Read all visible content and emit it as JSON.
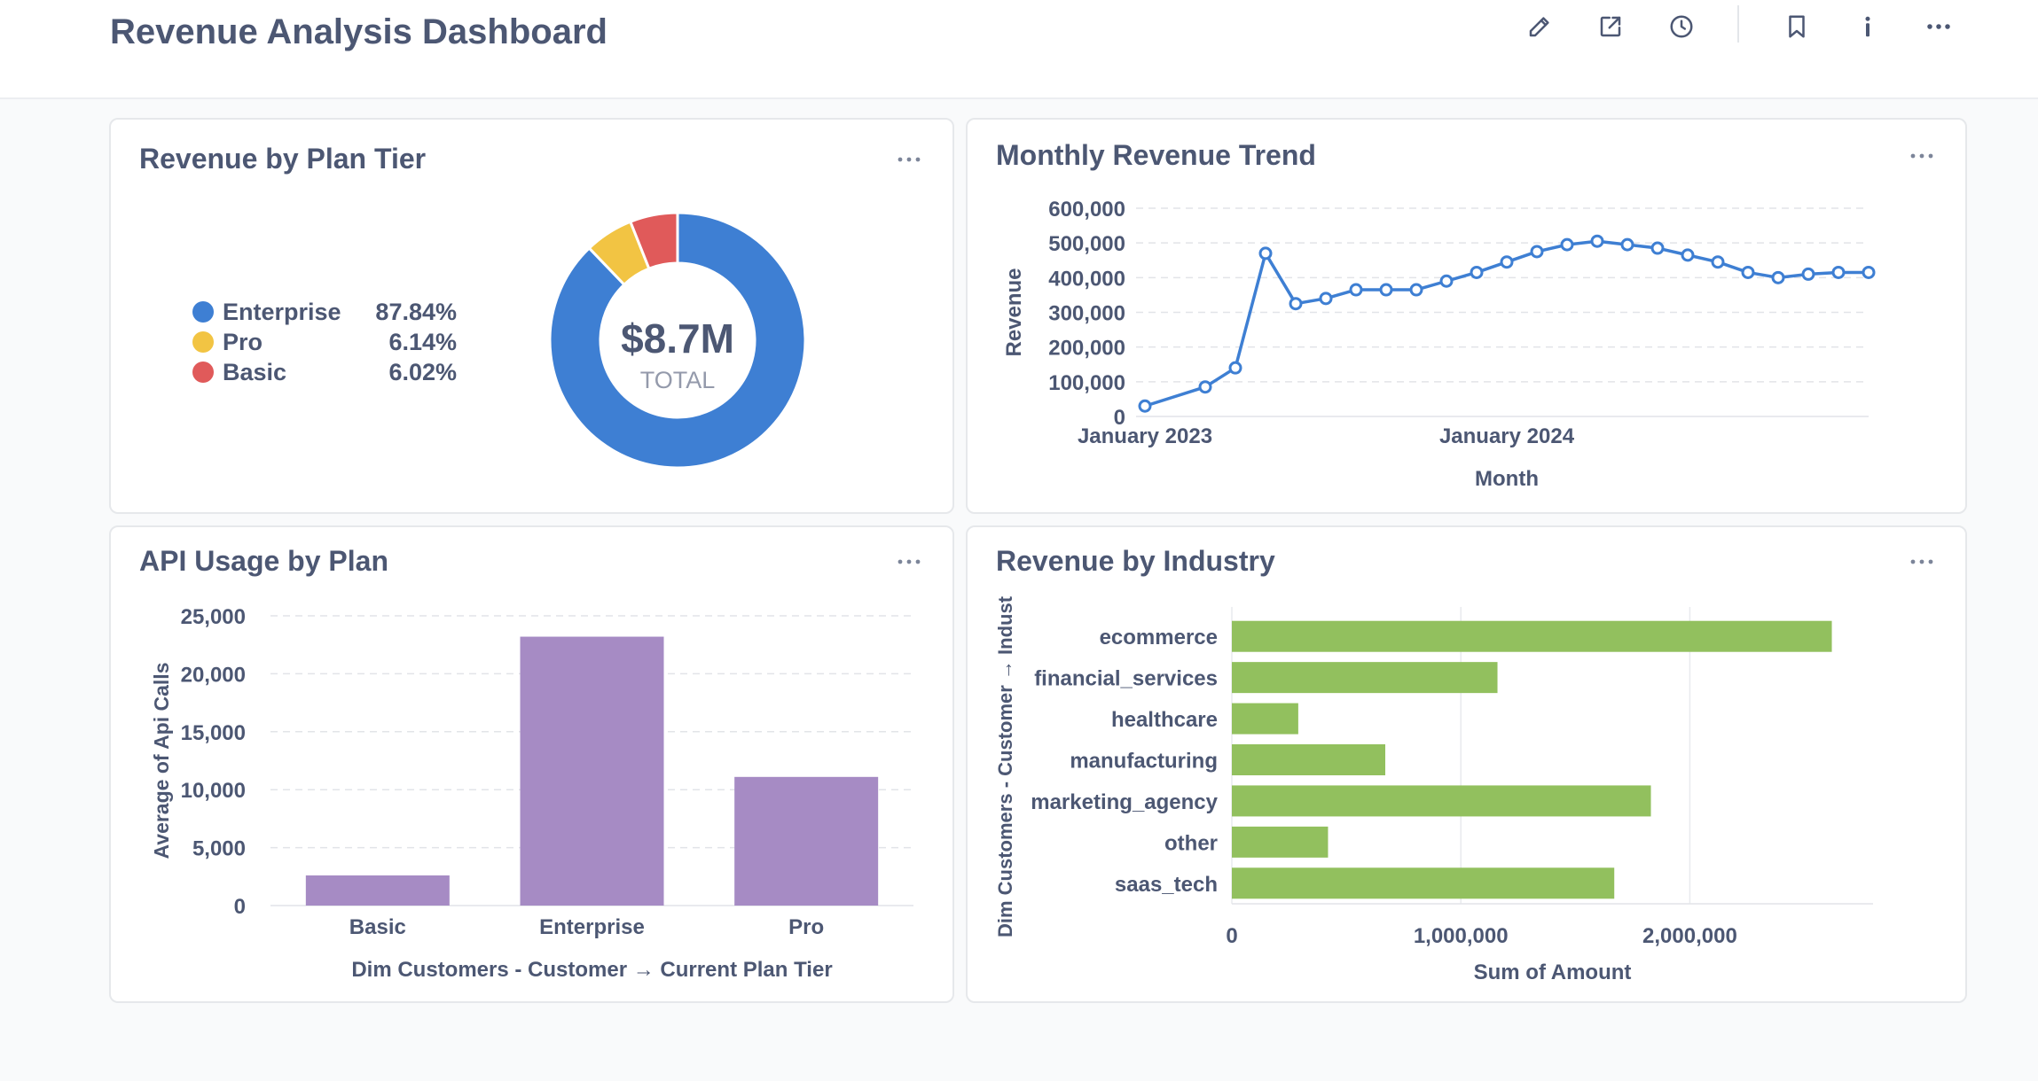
{
  "header": {
    "title": "Revenue Analysis Dashboard",
    "icons": [
      "pencil-icon",
      "share-icon",
      "history-icon",
      "bookmark-icon",
      "info-icon",
      "more-icon"
    ]
  },
  "colors": {
    "accent": "#509ee3",
    "enterprise": "#3e7fd3",
    "pro": "#f2c443",
    "basic": "#e05a5a",
    "line": "#3e7fd3",
    "api_bar": "#a68bc4",
    "industry_bar": "#92c05e"
  },
  "cards": {
    "plan_tier": {
      "title": "Revenue by Plan Tier",
      "center_value": "$8.7M",
      "center_label": "TOTAL"
    },
    "monthly_trend": {
      "title": "Monthly Revenue Trend"
    },
    "api_usage": {
      "title": "API Usage by Plan"
    },
    "industry": {
      "title": "Revenue by Industry"
    }
  },
  "chart_data": [
    {
      "type": "pie",
      "title": "Revenue by Plan Tier",
      "donut": true,
      "legend_position": "left",
      "slices": [
        {
          "label": "Enterprise",
          "percent": 87.84,
          "percent_label": "87.84%",
          "color": "#3e7fd3"
        },
        {
          "label": "Pro",
          "percent": 6.14,
          "percent_label": "6.14%",
          "color": "#f2c443"
        },
        {
          "label": "Basic",
          "percent": 6.02,
          "percent_label": "6.02%",
          "color": "#e05a5a"
        }
      ]
    },
    {
      "type": "line",
      "title": "Monthly Revenue Trend",
      "xlabel": "Month",
      "ylabel": "Revenue",
      "x": [
        "2023-01",
        "2023-03",
        "2023-04",
        "2023-05",
        "2023-06",
        "2023-07",
        "2023-08",
        "2023-09",
        "2023-10",
        "2023-11",
        "2023-12",
        "2024-01",
        "2024-02",
        "2024-03",
        "2024-04",
        "2024-05",
        "2024-06",
        "2024-07",
        "2024-08",
        "2024-09",
        "2024-10",
        "2024-11",
        "2024-12",
        "2025-01"
      ],
      "x_ticks": [
        "January 2023",
        "January 2024"
      ],
      "y": [
        30000,
        85000,
        140000,
        470000,
        325000,
        340000,
        365000,
        365000,
        365000,
        390000,
        415000,
        445000,
        475000,
        495000,
        505000,
        495000,
        485000,
        465000,
        445000,
        415000,
        400000,
        410000,
        415000,
        415000
      ],
      "ylim": [
        0,
        600000
      ],
      "y_ticks": [
        "0",
        "100,000",
        "200,000",
        "300,000",
        "400,000",
        "500,000",
        "600,000"
      ],
      "grid": true
    },
    {
      "type": "bar",
      "title": "API Usage by Plan",
      "categories": [
        "Basic",
        "Enterprise",
        "Pro"
      ],
      "values": [
        2600,
        23200,
        11100
      ],
      "xlabel": "Dim Customers - Customer → Current Plan Tier",
      "ylabel": "Average of Api Calls",
      "ylim": [
        0,
        25000
      ],
      "y_ticks": [
        "0",
        "5,000",
        "10,000",
        "15,000",
        "20,000",
        "25,000"
      ],
      "grid": true
    },
    {
      "type": "bar",
      "orientation": "horizontal",
      "title": "Revenue by Industry",
      "categories": [
        "ecommerce",
        "financial_services",
        "healthcare",
        "manufacturing",
        "marketing_agency",
        "other",
        "saas_tech"
      ],
      "values": [
        2620000,
        1160000,
        290000,
        670000,
        1830000,
        420000,
        1670000
      ],
      "xlabel": "Sum of Amount",
      "ylabel": "Dim Customers - Customer → Indust",
      "xlim": [
        0,
        2800000
      ],
      "x_ticks": [
        "0",
        "1,000,000",
        "2,000,000"
      ],
      "grid": true
    }
  ]
}
